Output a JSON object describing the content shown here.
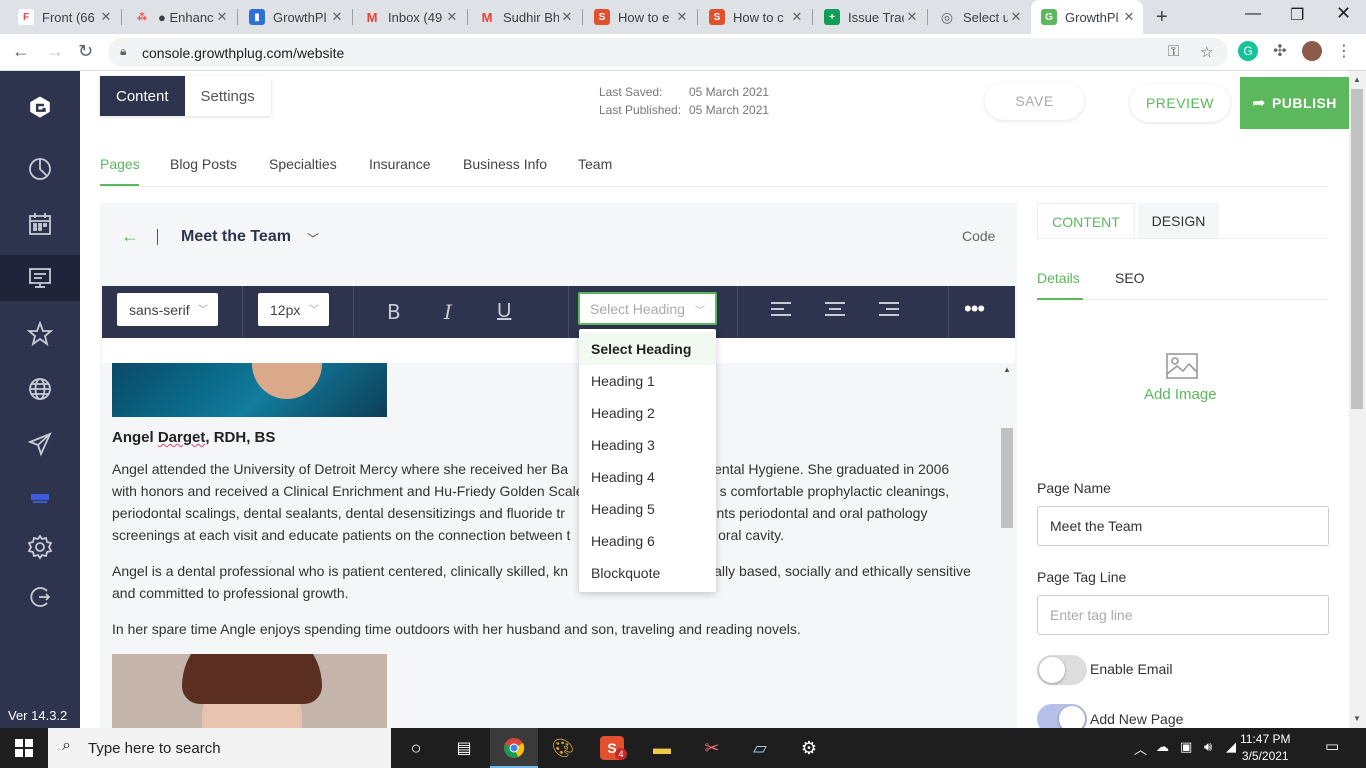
{
  "browser": {
    "tabs": [
      {
        "title": "Front (66",
        "color": "#e8494f",
        "glyph": "F"
      },
      {
        "title": "● Enhanc",
        "color": "#e8494f",
        "glyph": "●"
      },
      {
        "title": "GrowthPl",
        "color": "#2e6fd8",
        "glyph": "▮"
      },
      {
        "title": "Inbox (49",
        "color": "#ea4335",
        "glyph": "M"
      },
      {
        "title": "Sudhir Bh",
        "color": "#ea4335",
        "glyph": "M"
      },
      {
        "title": "How to e",
        "color": "#e2502d",
        "glyph": "S"
      },
      {
        "title": "How to c",
        "color": "#e2502d",
        "glyph": "S"
      },
      {
        "title": "Issue Trac",
        "color": "#0f9d58",
        "glyph": "+"
      },
      {
        "title": "Select us",
        "color": "#5f6368",
        "glyph": "◎"
      },
      {
        "title": "GrowthPl",
        "color": "#5cb85c",
        "glyph": "G"
      }
    ],
    "url": "console.growthplug.com/website"
  },
  "sidebar": {
    "icons": [
      "logo-icon",
      "pie-chart-icon",
      "calendar-icon",
      "monitor-icon",
      "star-icon",
      "globe-icon",
      "send-icon",
      "brand-icon",
      "gear-icon",
      "logout-icon"
    ],
    "version": "Ver 14.3.2"
  },
  "header": {
    "content_label": "Content",
    "settings_label": "Settings",
    "last_saved_label": "Last Saved:",
    "last_saved_value": "05 March 2021",
    "last_published_label": "Last Published:",
    "last_published_value": "05 March 2021",
    "save": "SAVE",
    "preview": "PREVIEW",
    "publish": "PUBLISH"
  },
  "page_tabs": [
    "Pages",
    "Blog Posts",
    "Specialties",
    "Insurance",
    "Business Info",
    "Team"
  ],
  "editor": {
    "page_title": "Meet the Team",
    "code": "Code",
    "font_family": "sans-serif",
    "font_size": "12px",
    "bold": "B",
    "italic": "I",
    "underline": "U",
    "heading_placeholder": "Select Heading",
    "more": "•••",
    "heading_options": [
      "Select Heading",
      "Heading 1",
      "Heading 2",
      "Heading 3",
      "Heading 4",
      "Heading 5",
      "Heading 6",
      "Blockquote"
    ]
  },
  "content": {
    "person_name": "Angel Darget, RDH, BS",
    "p1_line1": "Angel attended the University of Detroit Mercy where she received her Ba",
    "p1_line1b": "Dental Hygiene. She graduated in 2006",
    "p1_line2": "with honors and received a Clinical Enrichment and Hu-Friedy Golden Scale",
    "p1_line2b": "s comfortable prophylactic cleanings,",
    "p1_line3": "periodontal scalings, dental sealants, dental desensitizings and fluoride tr",
    "p1_line3b": "nents periodontal and oral pathology",
    "p1_line4": "screenings at each visit and educate patients on the connection between t",
    "p1_line4b": "e oral cavity.",
    "p2_line1": "Angel is a dental professional who is patient centered, clinically skilled, kn",
    "p2_line1b": "ically based, socially and ethically sensitive",
    "p2_line2": "and committed to professional growth.",
    "p3": "In her spare time Angle enjoys spending time outdoors with her husband and son, traveling and reading novels."
  },
  "right_panel": {
    "tab_content": "CONTENT",
    "tab_design": "DESIGN",
    "sub_details": "Details",
    "sub_seo": "SEO",
    "add_image": "Add Image",
    "page_name_label": "Page Name",
    "page_name_value": "Meet the Team",
    "tag_line_label": "Page Tag Line",
    "tag_line_placeholder": "Enter tag line",
    "enable_email": "Enable Email",
    "add_new_page": "Add New Page"
  },
  "taskbar": {
    "search_placeholder": "Type here to search",
    "time": "11:47 PM",
    "date": "3/5/2021",
    "skype_badge": "4"
  },
  "colors": {
    "accent": "#5cb85c",
    "navy": "#2e344e"
  }
}
